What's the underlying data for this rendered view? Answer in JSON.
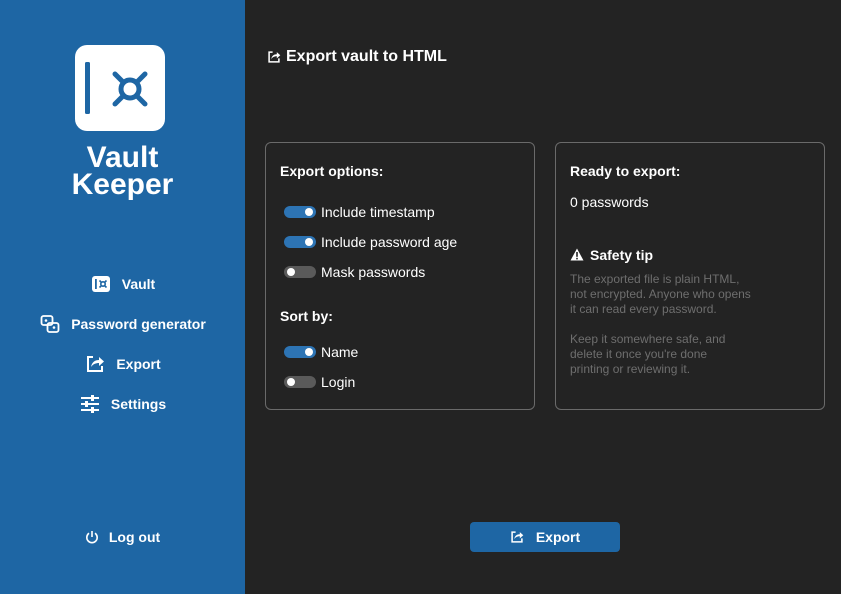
{
  "app": {
    "name_line1": "Vault",
    "name_line2": "Keeper",
    "logo_icon": "vault-dial-icon"
  },
  "sidebar": {
    "items": [
      {
        "label": "Vault",
        "icon": "vault-icon"
      },
      {
        "label": "Password generator",
        "icon": "password-generator-icon"
      },
      {
        "label": "Export",
        "icon": "export-share-icon"
      },
      {
        "label": "Settings",
        "icon": "sliders-icon"
      }
    ],
    "logout_label": "Log out",
    "logout_icon": "power-icon"
  },
  "page": {
    "title": "Export vault to HTML",
    "title_icon": "export-share-icon"
  },
  "options": {
    "heading": "Export options:",
    "toggles": [
      {
        "label": "Include timestamp",
        "on": true
      },
      {
        "label": "Include password age",
        "on": true
      },
      {
        "label": "Mask passwords",
        "on": false
      }
    ],
    "sort_heading": "Sort by:",
    "sort": [
      {
        "label": "Name",
        "on": true
      },
      {
        "label": "Login",
        "on": false
      }
    ]
  },
  "ready": {
    "heading": "Ready to export:",
    "count_text": "0 passwords",
    "tip_title": "Safety tip",
    "tip_icon": "warning-icon",
    "tip_p1_lines": [
      "The exported file is plain HTML,",
      "not encrypted. Anyone who opens",
      "it can read every password."
    ],
    "tip_p2_lines": [
      "Keep it somewhere safe, and",
      "delete it once you're done",
      "printing or reviewing it."
    ]
  },
  "export_button": {
    "label": "Export",
    "icon": "export-share-icon"
  },
  "colors": {
    "sidebar": "#1e66a4",
    "background": "#232323",
    "toggle_on": "#2d74b4",
    "toggle_off": "#5a5a5a",
    "muted_text": "#6e6e6e"
  }
}
